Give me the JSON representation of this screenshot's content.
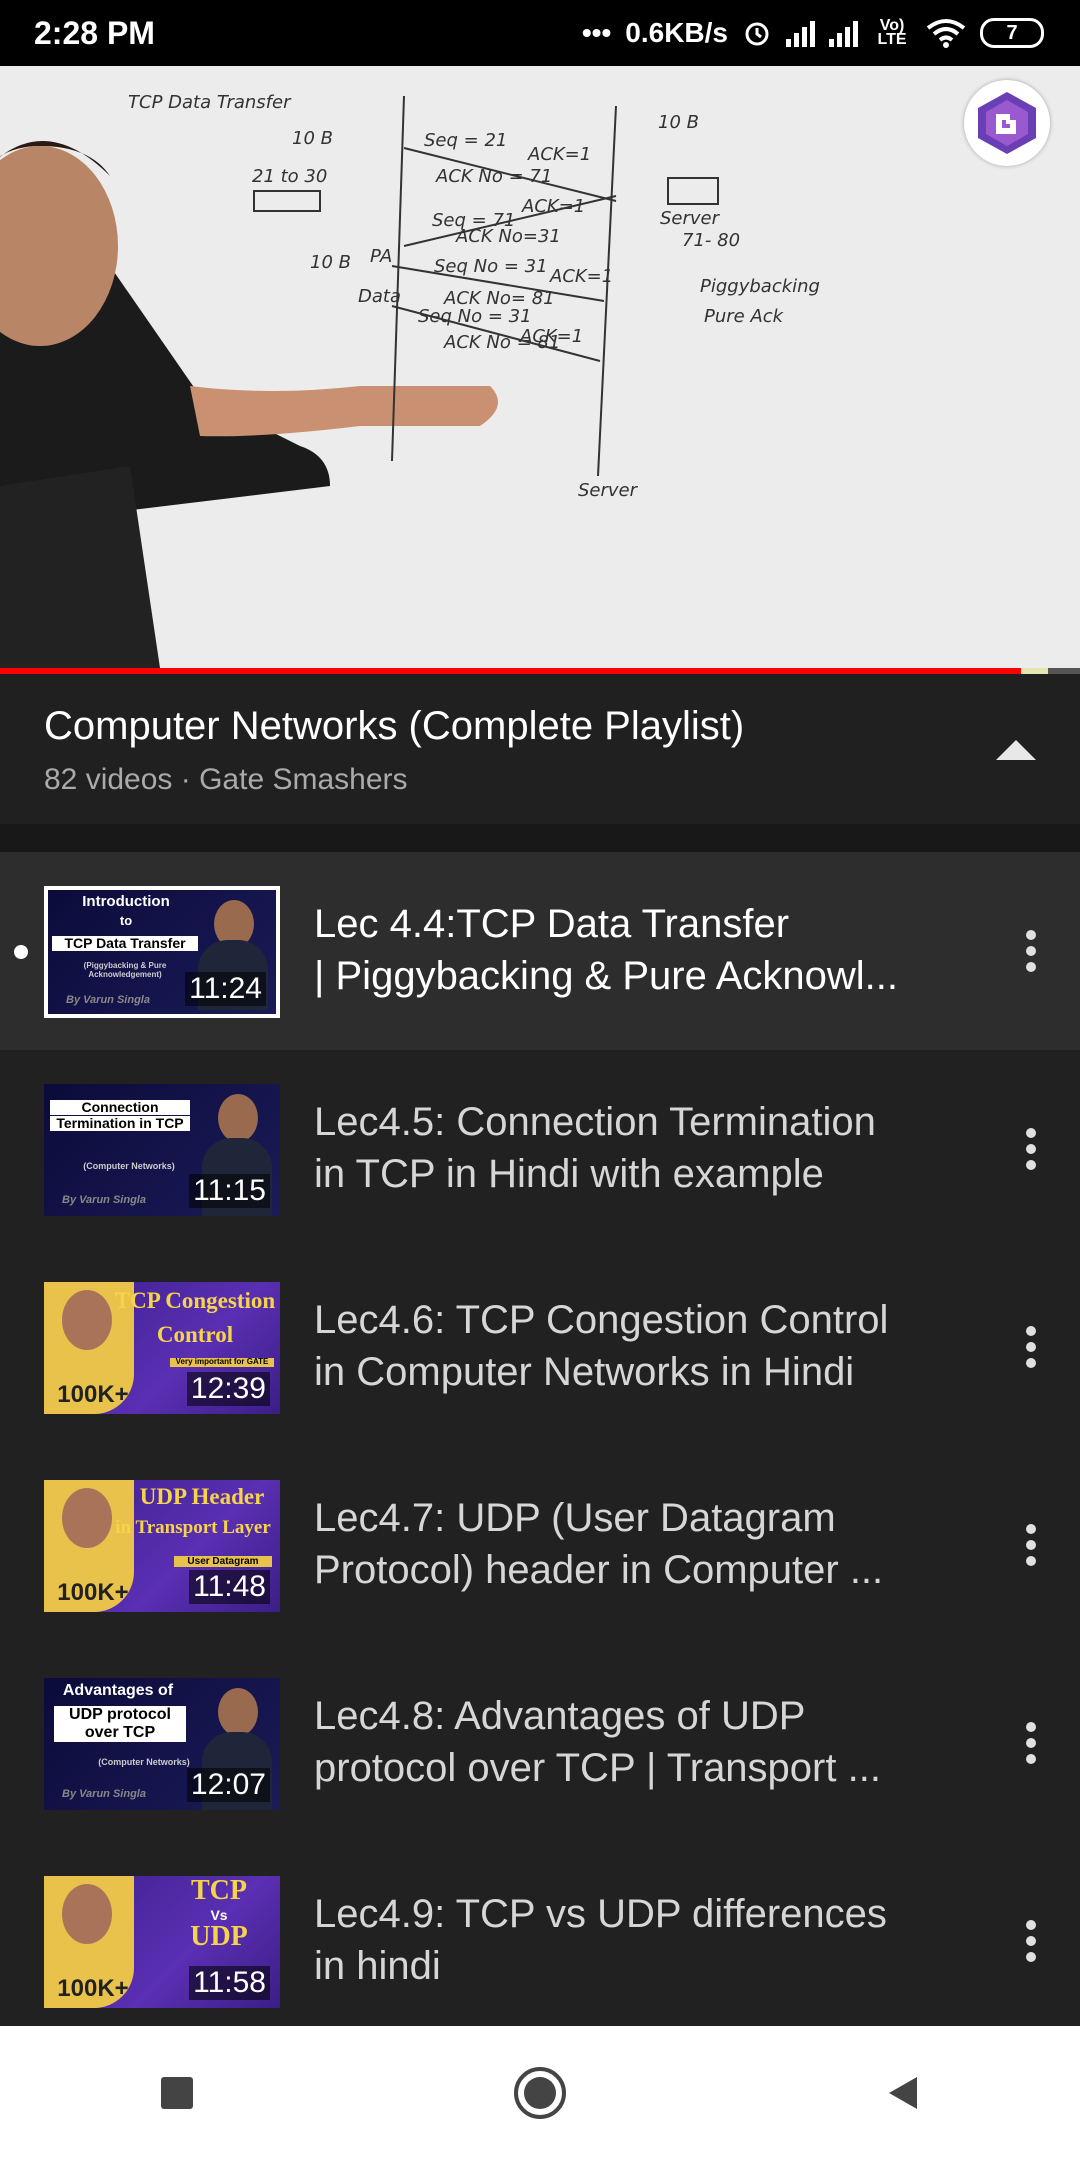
{
  "status": {
    "time": "2:28 PM",
    "net_speed": "0.6KB/s",
    "network": "Vo) LTE",
    "battery": "7"
  },
  "video": {
    "progress_fraction": 0.945,
    "buffer_fraction": 0.97,
    "board": {
      "title": "TCP Data Transfer",
      "size_left": "10 B",
      "range": "21 to 30",
      "size_right": "10 B",
      "server_label": "Server",
      "server_range": "71- 80",
      "bottom_server": "Server",
      "pa_label": "PA",
      "data_label": "Data",
      "size_mid": "10 B",
      "lines": [
        "Seq = 21",
        "ACK=1",
        "ACK No = 71",
        "Seq = 71",
        "ACK=1",
        "ACK No=31",
        "Seq No = 31",
        "ACK=1",
        "ACK No= 81",
        "Seq No = 31",
        "ACK=1",
        "ACK No = 81"
      ],
      "notes": [
        "Piggybacking",
        "Pure Ack"
      ]
    }
  },
  "playlist": {
    "title": "Computer Networks (Complete Playlist)",
    "subtitle": "82 videos · Gate Smashers",
    "items": [
      {
        "title_line1": "Lec 4.4:TCP Data Transfer",
        "title_line2": "| Piggybacking & Pure Acknowl...",
        "duration": "11:24",
        "thumb_lines": [
          "Introduction",
          "to",
          "TCP Data Transfer",
          "(Piggybacking & Pure Acknowledgement)"
        ],
        "thumb_credit": "By Varun Singla"
      },
      {
        "title_line1": "Lec4.5: Connection Termination",
        "title_line2": "in TCP in Hindi with example",
        "duration": "11:15",
        "thumb_lines": [
          "Connection",
          "Termination in TCP",
          "(Computer Networks)"
        ],
        "thumb_credit": "By Varun Singla"
      },
      {
        "title_line1": "Lec4.6: TCP Congestion Control",
        "title_line2": "in Computer Networks in Hindi",
        "duration": "12:39",
        "thumb_lines": [
          "TCP Congestion",
          "Control",
          "Very important for GATE"
        ],
        "thumb_badge": "100K+"
      },
      {
        "title_line1": "Lec4.7: UDP (User Datagram",
        "title_line2": "Protocol) header in Computer ...",
        "duration": "11:48",
        "thumb_lines": [
          "UDP Header",
          "in Transport Layer",
          "User Datagram"
        ],
        "thumb_badge": "100K+"
      },
      {
        "title_line1": "Lec4.8: Advantages of UDP",
        "title_line2": "protocol over TCP | Transport ...",
        "duration": "12:07",
        "thumb_lines": [
          "Advantages of",
          "UDP protocol",
          "over TCP",
          "(Computer Networks)"
        ],
        "thumb_credit": "By Varun Singla"
      },
      {
        "title_line1": "Lec4.9: TCP vs UDP differences",
        "title_line2": "in hindi",
        "duration": "11:58",
        "thumb_lines": [
          "TCP",
          "Vs",
          "UDP"
        ],
        "thumb_badge": "100K+"
      }
    ]
  },
  "icons": {
    "collapse": "chevron-up-icon",
    "more": "more-vert-icon",
    "nav": [
      "recent-apps-icon",
      "home-icon",
      "back-icon"
    ]
  }
}
